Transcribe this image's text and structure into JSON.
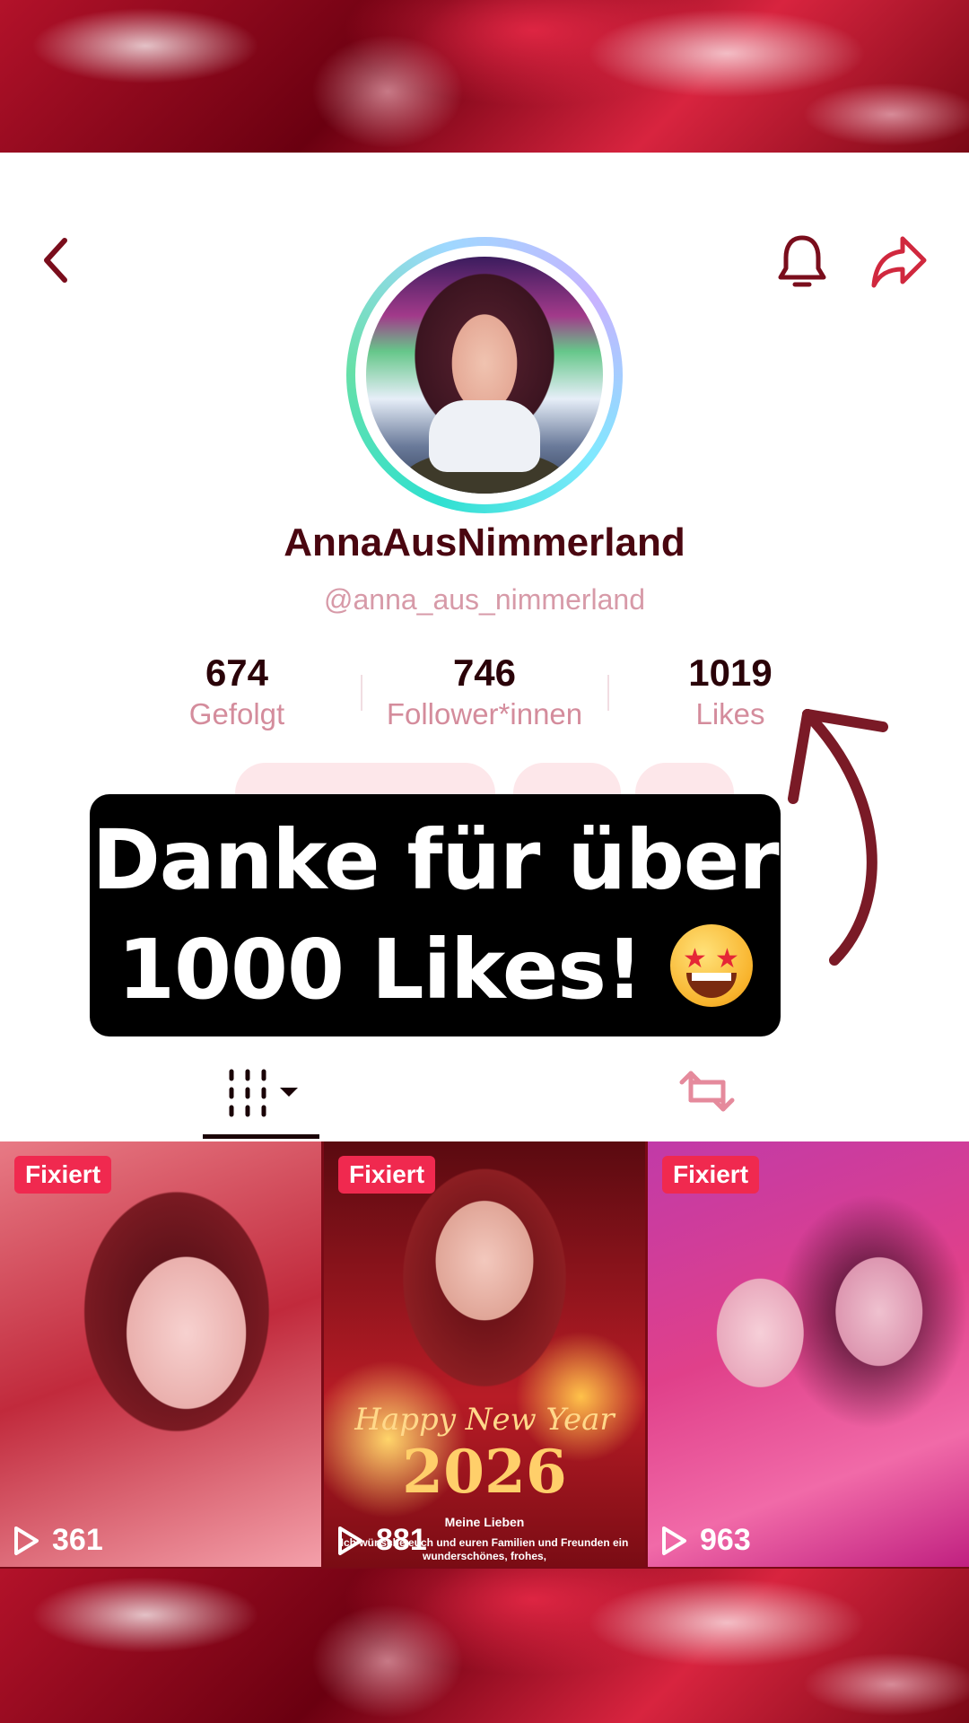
{
  "profile": {
    "display_name": "AnnaAusNimmerland",
    "username": "@anna_aus_nimmerland"
  },
  "stats": [
    {
      "value": "674",
      "label": "Gefolgt"
    },
    {
      "value": "746",
      "label": "Follower*innen"
    },
    {
      "value": "1019",
      "label": "Likes"
    }
  ],
  "banner": {
    "line1": "Danke für über",
    "line2": "1000 Likes!"
  },
  "icons": {
    "back": "chevron-left-icon",
    "bell": "bell-icon",
    "share": "share-icon",
    "grid": "videos-grid-icon",
    "repost": "repost-icon",
    "play": "play-icon",
    "emoji": "star-struck-emoji"
  },
  "videos": [
    {
      "pin_label": "Fixiert",
      "views": "361"
    },
    {
      "pin_label": "Fixiert",
      "views": "881",
      "overlay_title": "Happy New Year",
      "overlay_year": "2026",
      "overlay_line1": "Meine Lieben",
      "overlay_line2": "Ich wünsche euch und euren Familien und Freunden ein wunderschönes, frohes,"
    },
    {
      "pin_label": "Fixiert",
      "views": "963"
    }
  ],
  "colors": {
    "accent": "#f0294f",
    "name": "#4a0610",
    "label": "#d48c9c"
  }
}
